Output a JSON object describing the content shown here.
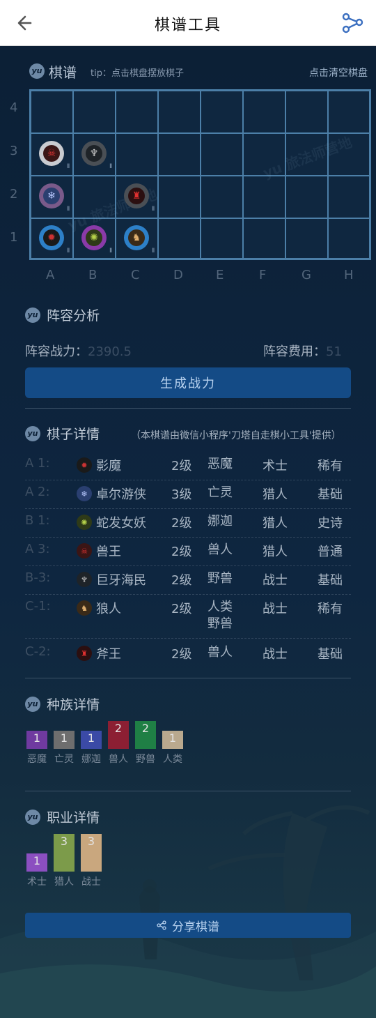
{
  "header": {
    "title": "棋谱工具",
    "back_icon": "arrow-left-icon",
    "share_icon": "share-icon"
  },
  "board_section": {
    "title": "棋谱",
    "tip": "tip：点击棋盘摆放棋子",
    "clear": "点击清空棋盘",
    "row_labels": [
      "4",
      "3",
      "2",
      "1"
    ],
    "col_labels": [
      "A",
      "B",
      "C",
      "D",
      "E",
      "F",
      "G",
      "H"
    ],
    "level_mark": "II"
  },
  "analysis": {
    "title": "阵容分析",
    "power_label": "阵容战力：",
    "power_value": "2390.5",
    "cost_label": "阵容费用：",
    "cost_value": "51",
    "generate_button": "生成战力"
  },
  "details": {
    "title": "棋子详情",
    "provided_by": "（本棋谱由微信小程序'刀塔自走棋小工具'提供）",
    "rows": [
      {
        "pos": "A 1:",
        "name": "影魔",
        "level": "2级",
        "race": "恶魔",
        "class": "术士",
        "rarity": "稀有"
      },
      {
        "pos": "A 2:",
        "name": "卓尔游侠",
        "level": "3级",
        "race": "亡灵",
        "class": "猎人",
        "rarity": "基础"
      },
      {
        "pos": "B 1:",
        "name": "蛇发女妖",
        "level": "2级",
        "race": "娜迦",
        "class": "猎人",
        "rarity": "史诗"
      },
      {
        "pos": "A 3:",
        "name": "兽王",
        "level": "2级",
        "race": "兽人",
        "class": "猎人",
        "rarity": "普通"
      },
      {
        "pos": "B-3:",
        "name": "巨牙海民",
        "level": "2级",
        "race": "野兽",
        "class": "战士",
        "rarity": "基础"
      },
      {
        "pos": "C-1:",
        "name": "狼人",
        "level": "2级",
        "race": "人类\n野兽",
        "class": "战士",
        "rarity": "稀有"
      },
      {
        "pos": "C-2:",
        "name": "斧王",
        "level": "2级",
        "race": "兽人",
        "class": "战士",
        "rarity": "基础"
      }
    ]
  },
  "race_section": {
    "title": "种族详情",
    "bars": [
      {
        "label": "恶魔",
        "count": "1",
        "color": "#6f3aa0"
      },
      {
        "label": "亡灵",
        "count": "1",
        "color": "#6e6e6e"
      },
      {
        "label": "娜迦",
        "count": "1",
        "color": "#3b4aa6"
      },
      {
        "label": "兽人",
        "count": "2",
        "color": "#8c1f33"
      },
      {
        "label": "野兽",
        "count": "2",
        "color": "#1f7f45"
      },
      {
        "label": "人类",
        "count": "1",
        "color": "#b9a98e"
      }
    ]
  },
  "class_section": {
    "title": "职业详情",
    "bars": [
      {
        "label": "术士",
        "count": "1",
        "color": "#8b4fc0"
      },
      {
        "label": "猎人",
        "count": "3",
        "color": "#7c9b4a"
      },
      {
        "label": "战士",
        "count": "3",
        "color": "#c9a77e"
      }
    ]
  },
  "share_button": "分享棋谱",
  "watermark_text": "yu 旅法师营地",
  "colors": {
    "accent": "#144b86",
    "board_line": "#4c7fa8",
    "background": "#0c2036"
  }
}
